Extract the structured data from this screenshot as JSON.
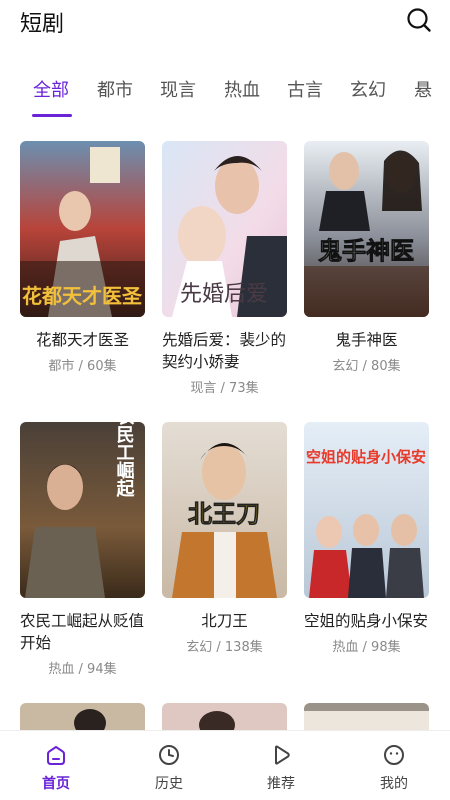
{
  "header": {
    "title": "短剧"
  },
  "tabs": [
    "全部",
    "都市",
    "现言",
    "热血",
    "古言",
    "玄幻",
    "悬"
  ],
  "cards": [
    {
      "title": "花都天才医圣",
      "meta": "都市 / 60集",
      "poster_text": "花都天才医圣"
    },
    {
      "title": "先婚后爱：裴少的契约小娇妻",
      "meta": "现言 / 73集",
      "poster_text": "先婚后爱"
    },
    {
      "title": "鬼手神医",
      "meta": "玄幻 / 80集",
      "poster_text": "鬼手神医"
    },
    {
      "title": "农民工崛起从贬值开始",
      "meta": "热血 / 94集",
      "poster_text": "农民工崛起"
    },
    {
      "title": "北刀王",
      "meta": "玄幻 / 138集",
      "poster_text": "北王刀"
    },
    {
      "title": "空姐的贴身小保安",
      "meta": "热血 / 98集",
      "poster_text": "空姐的贴身小保安"
    }
  ],
  "bottom_nav": [
    {
      "label": "首页",
      "icon": "home-icon"
    },
    {
      "label": "历史",
      "icon": "clock-icon"
    },
    {
      "label": "推荐",
      "icon": "play-icon"
    },
    {
      "label": "我的",
      "icon": "face-icon"
    }
  ],
  "colors": {
    "accent": "#6a24d8"
  }
}
